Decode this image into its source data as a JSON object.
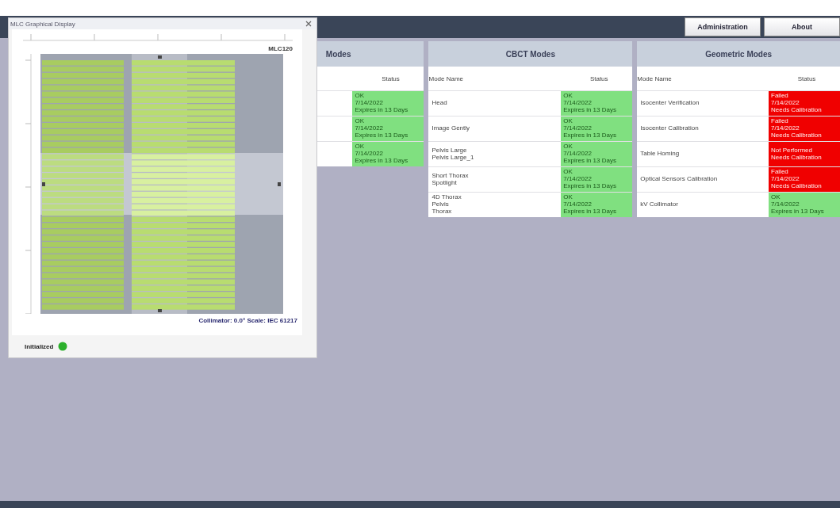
{
  "top_buttons": [
    "Administration",
    "About"
  ],
  "panels": [
    {
      "title": "Modes",
      "columns": [
        "Status"
      ],
      "rows": [
        {
          "name": "",
          "status": [
            "OK",
            "7/14/2022",
            "Expires in 13 Days"
          ],
          "passed": true
        },
        {
          "name": "",
          "status": [
            "OK",
            "7/14/2022",
            "Expires in 13 Days"
          ],
          "passed": true
        },
        {
          "name": "",
          "status": [
            "OK",
            "7/14/2022",
            "Expires in 13 Days"
          ],
          "passed": true
        }
      ]
    },
    {
      "title": "CBCT Modes",
      "columns": [
        "Mode Name",
        "Status"
      ],
      "rows": [
        {
          "name": "Head",
          "status": [
            "OK",
            "7/14/2022",
            "Expires in 13 Days"
          ],
          "passed": true
        },
        {
          "name": "Image Gently",
          "status": [
            "OK",
            "7/14/2022",
            "Expires in 13 Days"
          ],
          "passed": true
        },
        {
          "name": "Pelvis Large\nPelvis Large_1",
          "status": [
            "OK",
            "7/14/2022",
            "Expires in 13 Days"
          ],
          "passed": true
        },
        {
          "name": "Short Thorax\nSpotlight",
          "status": [
            "OK",
            "7/14/2022",
            "Expires in 13 Days"
          ],
          "passed": true
        },
        {
          "name": "4D Thorax\nPelvis\nThorax",
          "status": [
            "OK",
            "7/14/2022",
            "Expires in 13 Days"
          ],
          "passed": true
        }
      ]
    },
    {
      "title": "Geometric Modes",
      "columns": [
        "Mode Name",
        "Status"
      ],
      "rows": [
        {
          "name": "Isocenter Verification",
          "status": [
            "Failed",
            "7/14/2022",
            "Needs Calibration"
          ],
          "passed": false
        },
        {
          "name": "Isocenter Calibration",
          "status": [
            "Failed",
            "7/14/2022",
            "Needs Calibration"
          ],
          "passed": false
        },
        {
          "name": "Table Homing",
          "status": [
            "Not Performed",
            "Needs Calibration"
          ],
          "passed": false
        },
        {
          "name": "Optical Sensors Calibration",
          "status": [
            "Failed",
            "7/14/2022",
            "Needs Calibration"
          ],
          "passed": false
        },
        {
          "name": "kV Collimator",
          "status": [
            "OK",
            "7/14/2022",
            "Expires in 13 Days"
          ],
          "passed": true
        }
      ]
    }
  ],
  "mlc_window": {
    "title": "MLC Graphical Display",
    "model": "MLC120",
    "caption": "Collimator: 0.0°  Scale: IEC 61217",
    "status": "Initialized",
    "initialized": true
  }
}
